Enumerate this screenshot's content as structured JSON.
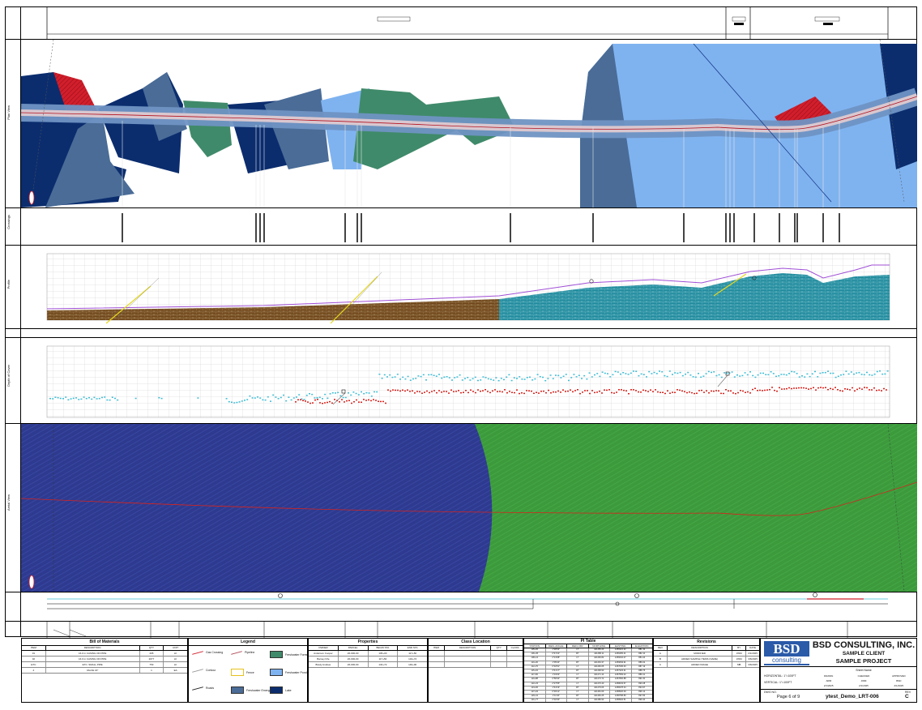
{
  "colors": {
    "navy": "#0b2d6e",
    "slate": "#4a6c97",
    "green": "#3f8a6a",
    "light_blue": "#7fb3f0",
    "red": "#d21e2c",
    "brown": "#6e4518",
    "teal": "#1e8a9c",
    "purple_line": "#a04fd6",
    "gis_blue": "#2e3a8f",
    "gis_green": "#3c9a3c",
    "cyan_points": "#3fbcd4",
    "red_points": "#d8231d"
  },
  "left_tabs": {
    "plan": "Plan View",
    "crossings": "Crossings",
    "profile": "Profile",
    "depth": "Depth of Cover",
    "aerial": "Aerial View"
  },
  "title_block": {
    "company": "BSD CONSULTING, INC.",
    "client": "SAMPLE CLIENT",
    "project": "SAMPLE PROJECT",
    "logo_top": "BSD",
    "logo_bottom": "consulting",
    "page_label": "Page",
    "page_num": "6",
    "page_of": "of",
    "page_total": "9",
    "drawing_no": "ytest_Demo_LRT-006",
    "rev": "C"
  },
  "tables": {
    "bom": {
      "title": "Bill of Materials",
      "cols": [
        "ITEM",
        "DESCRIPTION",
        "QTY",
        "UNIT"
      ],
      "rows": [
        [
          "01",
          "16.0 in CASING OD PIPE",
          "405",
          "LF"
        ],
        [
          "02",
          "16.0 in CASING OD PIPE",
          "2077",
          "LF"
        ],
        [
          "ETC",
          "ETC. SMALL PIPE",
          "753",
          "LF"
        ],
        [
          "4",
          "VALVE 16\"",
          "1",
          "EA"
        ]
      ]
    },
    "legend": {
      "title": "Legend",
      "items": [
        {
          "label": "Gas Crossing",
          "kind": "line",
          "color": "#d21e2c"
        },
        {
          "label": "Pipeline",
          "kind": "line",
          "color": "#b04a5a"
        },
        {
          "label": "Freshwater Forested/Shrub Wetland",
          "kind": "fill",
          "color": "#3f8a6a"
        },
        {
          "label": "Contour",
          "kind": "line",
          "color": "#999999"
        },
        {
          "label": "Fence",
          "kind": "box",
          "color": "#e6c21e"
        },
        {
          "label": "Freshwater Pond",
          "kind": "fill",
          "color": "#7fb3f0"
        },
        {
          "label": "Roads",
          "kind": "line",
          "color": "#222222"
        },
        {
          "label": "Freshwater Emergent Wetland",
          "kind": "fill",
          "color": "#4a6c97"
        },
        {
          "label": "Lake",
          "kind": "fill",
          "color": "#0b2d6e"
        }
      ]
    },
    "properties": {
      "title": "Properties",
      "cols": [
        "OWNER",
        "PARCEL",
        "BEGIN STA",
        "END STA"
      ],
      "rows": [
        [
          "Anderson Cooper",
          "26-000-00",
          "105+00",
          "117+50"
        ],
        [
          "Barney Fife",
          "26-000-00",
          "117+50",
          "134+72"
        ],
        [
          "Brady Andrew",
          "26-000-00",
          "134+72",
          "149+00"
        ]
      ]
    },
    "class": {
      "title": "Class Location",
      "cols": [
        "ITEM",
        "DESCRIPTION",
        "QTY",
        "CLASS"
      ],
      "rows": [
        [
          "",
          "",
          "",
          ""
        ],
        [
          "",
          "",
          "",
          ""
        ],
        [
          "",
          "",
          "",
          ""
        ]
      ]
    },
    "pi": {
      "title": "PI Table",
      "cols": [
        "STATION",
        "DEFL ANGLE",
        "DEFL DIR",
        "NORTHING",
        "EASTING",
        "ELEVATION"
      ],
      "rows": [
        [
          "105+00",
          "1°28'32\"",
          "LT",
          "421456.23",
          "1256321.22",
          "881.32"
        ],
        [
          "106+45",
          "0°47'22\"",
          "RT",
          "421458.11",
          "1256465.41",
          "882.10"
        ],
        [
          "108+12",
          "2°13'08\"",
          "LT",
          "421460.82",
          "1256632.07",
          "884.44"
        ],
        [
          "110+30",
          "1°05'44\"",
          "RT",
          "421463.37",
          "1256849.91",
          "886.02"
        ],
        [
          "112+76",
          "0°32'51\"",
          "LT",
          "421466.05",
          "1257095.63",
          "887.19"
        ],
        [
          "115+04",
          "3°41'17\"",
          "RT",
          "421468.90",
          "1257323.31",
          "888.75"
        ],
        [
          "117+50",
          "1°19'03\"",
          "LT",
          "421471.14",
          "1257569.02",
          "889.41"
        ],
        [
          "119+88",
          "0°58'40\"",
          "RT",
          "421473.72",
          "1257806.88",
          "891.60"
        ],
        [
          "122+15",
          "2°27'55\"",
          "LT",
          "421476.40",
          "1258033.57",
          "893.28"
        ],
        [
          "124+60",
          "1°44'19\"",
          "RT",
          "421479.06",
          "1258278.34",
          "894.97"
        ],
        [
          "127+02",
          "0°36'12\"",
          "LT",
          "421481.69",
          "1258520.09",
          "896.12"
        ],
        [
          "129+41",
          "1°11'46\"",
          "RT",
          "421484.25",
          "1258758.80",
          "897.83"
        ],
        [
          "131+77",
          "2°02'30\"",
          "LT",
          "421486.93",
          "1258994.51",
          "899.40"
        ],
        [
          "134+05",
          "0°49'08\"",
          "RT",
          "421489.47",
          "1259222.19",
          "900.66"
        ],
        [
          "136+40",
          "1°37'27\"",
          "LT",
          "421492.13",
          "1259456.92",
          "902.31"
        ],
        [
          "138+72",
          "0°25'53\"",
          "RT",
          "421494.70",
          "1259688.58",
          "903.85"
        ]
      ]
    },
    "revisions": {
      "title": "Revisions",
      "cols": [
        "REV",
        "DESCRIPTION",
        "BY",
        "DATE"
      ],
      "rows": [
        [
          "A",
          "MODIFIED",
          "JWM",
          "2/1/2025"
        ],
        [
          "B",
          "ADDED SAMPLE ITEMS (NAME)",
          "JWM",
          "3/6/2025"
        ],
        [
          "C",
          "ADDED IMAGE",
          "MB",
          "3/6/2025"
        ]
      ]
    }
  },
  "meta_cells": {
    "scale_h": "HORIZONTAL: 1\"=100FT",
    "scale_v": "VERTICAL: 1\"=100FT",
    "drawn": "DRAWN",
    "checked": "CHECKED",
    "approved": "APPROVED",
    "drawn_by": "JWM",
    "checked_by": "JWM",
    "approved_by": "BSD",
    "drawn_date": "2/1/2025",
    "checked_date": "2/1/2025",
    "approved_date": "2/1/2025",
    "sheet_title": "Sheet Name",
    "dwg_no_label": "DWG NO.",
    "rev_label": "REV"
  }
}
